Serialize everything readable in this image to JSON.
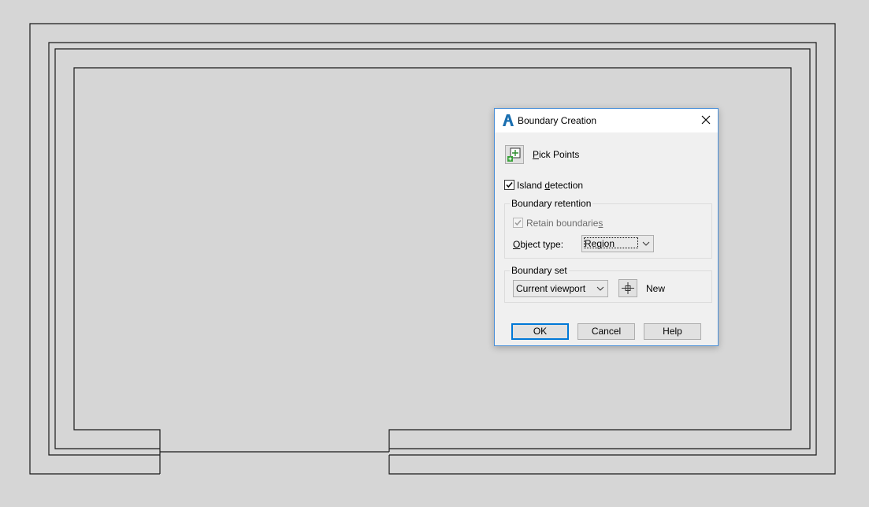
{
  "dialog": {
    "title": "Boundary Creation",
    "pick_points": {
      "accel": "P",
      "rest": "ick Points"
    },
    "island_detection": {
      "before": "Island ",
      "accel": "d",
      "after": "etection",
      "checked": true
    },
    "boundary_retention": {
      "group_title": "Boundary retention",
      "retain": {
        "before": "Retain boundarie",
        "accel": "s",
        "checked": true,
        "disabled": true
      },
      "object_type": {
        "accel": "O",
        "rest": "bject type:",
        "value": "Region"
      }
    },
    "boundary_set": {
      "group_title": "Boundary set",
      "value": "Current viewport",
      "new_label": "New"
    },
    "buttons": {
      "ok": "OK",
      "cancel": "Cancel",
      "help": "Help"
    }
  },
  "icons": {
    "app": "autocad-a-icon",
    "close": "close-icon",
    "pick": "pick-points-icon",
    "new": "crosshair-icon",
    "dropdown": "chevron-down-icon",
    "check": "checkmark-icon"
  },
  "colors": {
    "canvas": "#d6d6d6",
    "accent": "#0078d7",
    "dialog_border": "#4a8fd8",
    "line": "#1a1a1a"
  }
}
